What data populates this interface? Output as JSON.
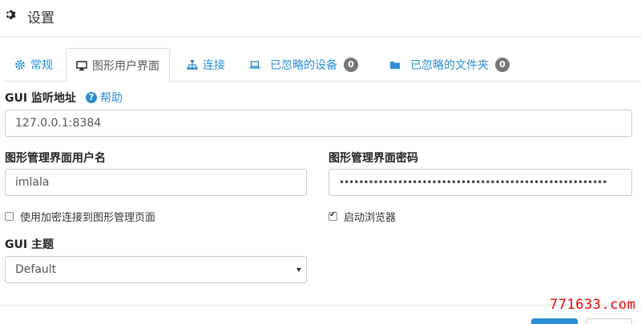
{
  "header": {
    "title": "设置",
    "icon": "gear-icon"
  },
  "tabs": [
    {
      "label": "常规",
      "icon": "gear-icon"
    },
    {
      "label": "图形用户界面",
      "icon": "desktop-icon",
      "active": true
    },
    {
      "label": "连接",
      "icon": "sitemap-icon"
    },
    {
      "label": "已忽略的设备",
      "icon": "laptop-icon",
      "badge": "0"
    },
    {
      "label": "已忽略的文件夹",
      "icon": "folder-icon",
      "badge": "0"
    }
  ],
  "gui": {
    "listen_label": "GUI 监听地址",
    "help_label": "帮助",
    "listen_value": "127.0.0.1:8384",
    "username_label": "图形管理界面用户名",
    "username_value": "imlala",
    "password_label": "图形管理界面密码",
    "password_value": "•••••••••••••••••••••••••••••••••••••••••••••••••••••••",
    "use_https_label": "使用加密连接到图形管理页面",
    "use_https_checked": false,
    "start_browser_label": "启动浏览器",
    "start_browser_checked": true,
    "theme_label": "GUI 主题",
    "theme_value": "Default"
  },
  "watermark": "771633.com",
  "colors": {
    "link": "#2a8ed5",
    "badge": "#777777",
    "watermark": "#ee0000"
  }
}
